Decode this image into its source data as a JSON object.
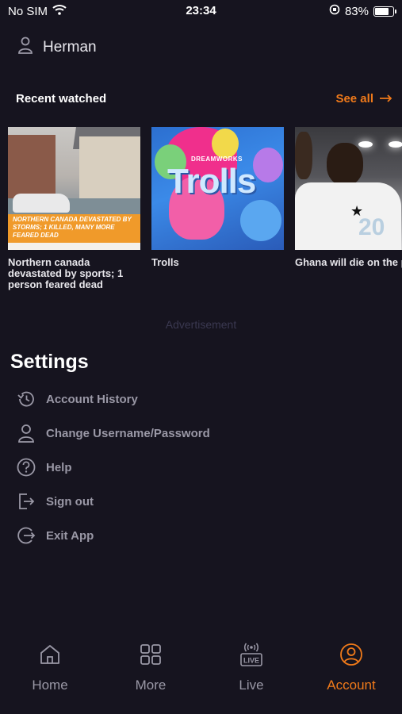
{
  "status_bar": {
    "carrier": "No SIM",
    "time": "23:34",
    "battery_percent": "83%",
    "battery_level": 0.83
  },
  "user": {
    "name": "Herman"
  },
  "recent": {
    "title": "Recent watched",
    "see_all": "See all",
    "items": [
      {
        "title": "Northern canada devastated by sports; 1 person feared dead",
        "banner": "NORTHERN CANADA DEVASTATED BY STORMS; 1 KILLED, MANY MORE FEARED DEAD"
      },
      {
        "title": "Trolls",
        "studio": "DREAMWORKS",
        "logo": "Trolls"
      },
      {
        "title": "Ghana will die on the pitch before giving up",
        "jersey_number": "20"
      }
    ]
  },
  "advertisement": "Advertisement",
  "settings": {
    "title": "Settings",
    "items": [
      {
        "label": "Account History",
        "icon": "history-icon"
      },
      {
        "label": "Change Username/Password",
        "icon": "user-icon"
      },
      {
        "label": "Help",
        "icon": "help-icon"
      },
      {
        "label": "Sign out",
        "icon": "sign-out-icon"
      },
      {
        "label": "Exit App",
        "icon": "exit-icon"
      }
    ]
  },
  "bottom_nav": {
    "items": [
      {
        "label": "Home",
        "icon": "home-icon"
      },
      {
        "label": "More",
        "icon": "grid-icon"
      },
      {
        "label": "Live",
        "icon": "live-icon"
      },
      {
        "label": "Account",
        "icon": "account-icon",
        "active": true
      }
    ]
  },
  "colors": {
    "background": "#16141f",
    "accent": "#f07a1a",
    "muted_text": "#9a98a6"
  }
}
